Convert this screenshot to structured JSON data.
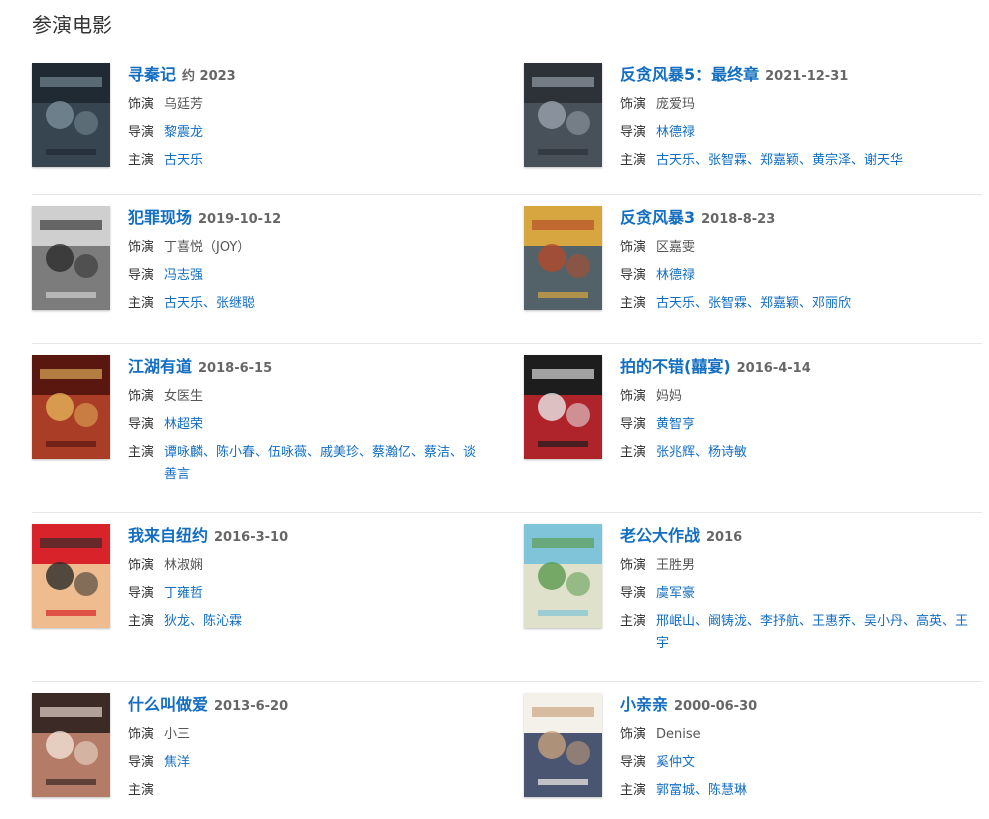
{
  "section_title": "参演电影",
  "labels": {
    "role": "饰演",
    "director": "导演",
    "cast": "主演"
  },
  "movies": [
    {
      "title": "寻秦记",
      "date": "约 2023",
      "role": "乌廷芳",
      "director": "黎震龙",
      "cast": "古天乐",
      "poster_colors": [
        "#1f2a33",
        "#3b4a55",
        "#7a8d99"
      ]
    },
    {
      "title": "反贪风暴5：最终章",
      "date": "2021-12-31",
      "role": "庞爱玛",
      "director": "林德禄",
      "cast": "古天乐、张智霖、郑嘉颖、黄宗泽、谢天华",
      "poster_colors": [
        "#2d3238",
        "#4e5660",
        "#9aa3ad"
      ]
    },
    {
      "title": "犯罪现场",
      "date": "2019-10-12",
      "role": "丁喜悦（JOY）",
      "director": "冯志强",
      "cast": "古天乐、张继聪",
      "poster_colors": [
        "#cfcfcf",
        "#6d6d6d",
        "#2c2c2c"
      ]
    },
    {
      "title": "反贪风暴3",
      "date": "2018-8-23",
      "role": "区嘉雯",
      "director": "林德禄",
      "cast": "古天乐、张智霖、郑嘉颖、邓丽欣",
      "poster_colors": [
        "#d8a640",
        "#3b5670",
        "#b44a2a"
      ]
    },
    {
      "title": "江湖有道",
      "date": "2018-6-15",
      "role": "女医生",
      "director": "林超荣",
      "cast": "谭咏麟、陈小春、伍咏薇、戚美珍、蔡瀚亿、蔡洁、谈善言",
      "poster_colors": [
        "#5a1710",
        "#b8442a",
        "#e3b25a"
      ]
    },
    {
      "title": "拍的不错(囍宴)",
      "date": "2016-4-14",
      "role": "妈妈",
      "director": "黄智亨",
      "cast": "张兆辉、杨诗敏",
      "poster_colors": [
        "#1d1d1d",
        "#c9262e",
        "#e9e9e9"
      ]
    },
    {
      "title": "我来自纽约",
      "date": "2016-3-10",
      "role": "林淑娴",
      "director": "丁雍哲",
      "cast": "狄龙、陈沁霖",
      "poster_colors": [
        "#d8232a",
        "#f2d7a0",
        "#2b2b2b"
      ]
    },
    {
      "title": "老公大作战",
      "date": "2016",
      "role": "王胜男",
      "director": "虞军豪",
      "cast": "邢岷山、阚铸泷、李抒航、王惠乔、吴小丹、高英、王宇",
      "poster_colors": [
        "#7fc4d8",
        "#f0e6c8",
        "#5a9a4c"
      ]
    },
    {
      "title": "什么叫做爱",
      "date": "2013-6-20",
      "role": "小三",
      "director": "焦洋",
      "cast": "",
      "poster_colors": [
        "#3c2a26",
        "#c98a72",
        "#f1e2d6"
      ]
    },
    {
      "title": "小亲亲",
      "date": "2000-06-30",
      "role": "Denise",
      "director": "奚仲文",
      "cast": "郭富城、陈慧琳",
      "poster_colors": [
        "#f4f1ea",
        "#2a3a5c",
        "#c7a07a"
      ]
    }
  ]
}
